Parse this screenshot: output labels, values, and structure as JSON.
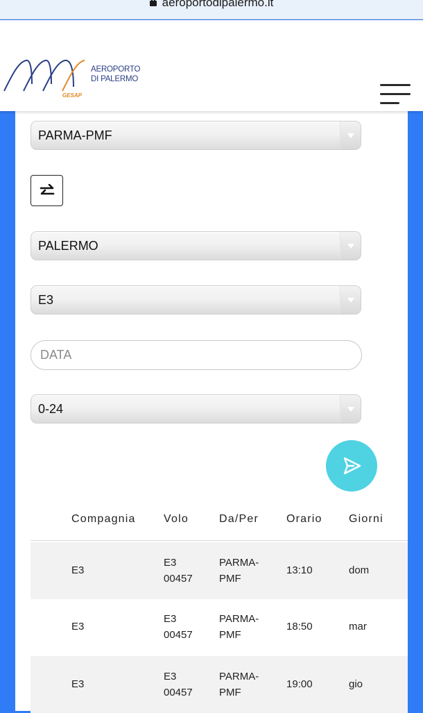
{
  "browser": {
    "url": "aeroportodipalermo.it"
  },
  "header": {
    "logo_line1": "AEROPORTO",
    "logo_line2": "DI PALERMO",
    "logo_sub": "GESAP"
  },
  "form": {
    "departure": "PARMA-PMF",
    "arrival": "PALERMO",
    "airline": "E3",
    "date_placeholder": "DATA",
    "time_range": "0-24"
  },
  "table": {
    "headers": {
      "company": "Compagnia",
      "flight": "Volo",
      "from_to": "Da/Per",
      "time": "Orario",
      "days": "Giorni"
    },
    "rows": [
      {
        "company": "E3",
        "flight_l1": "E3",
        "flight_l2": "00457",
        "from_l1": "PARMA-",
        "from_l2": "PMF",
        "time": "13:10",
        "day": "dom"
      },
      {
        "company": "E3",
        "flight_l1": "E3",
        "flight_l2": "00457",
        "from_l1": "PARMA-",
        "from_l2": "PMF",
        "time": "18:50",
        "day": "mar"
      },
      {
        "company": "E3",
        "flight_l1": "E3",
        "flight_l2": "00457",
        "from_l1": "PARMA-",
        "from_l2": "PMF",
        "time": "19:00",
        "day": "gio"
      }
    ]
  },
  "colors": {
    "page_bg": "#2f7cf6",
    "send_button": "#4fd2e2",
    "logo_blue": "#2a3f86",
    "logo_orange": "#e08a2a"
  }
}
